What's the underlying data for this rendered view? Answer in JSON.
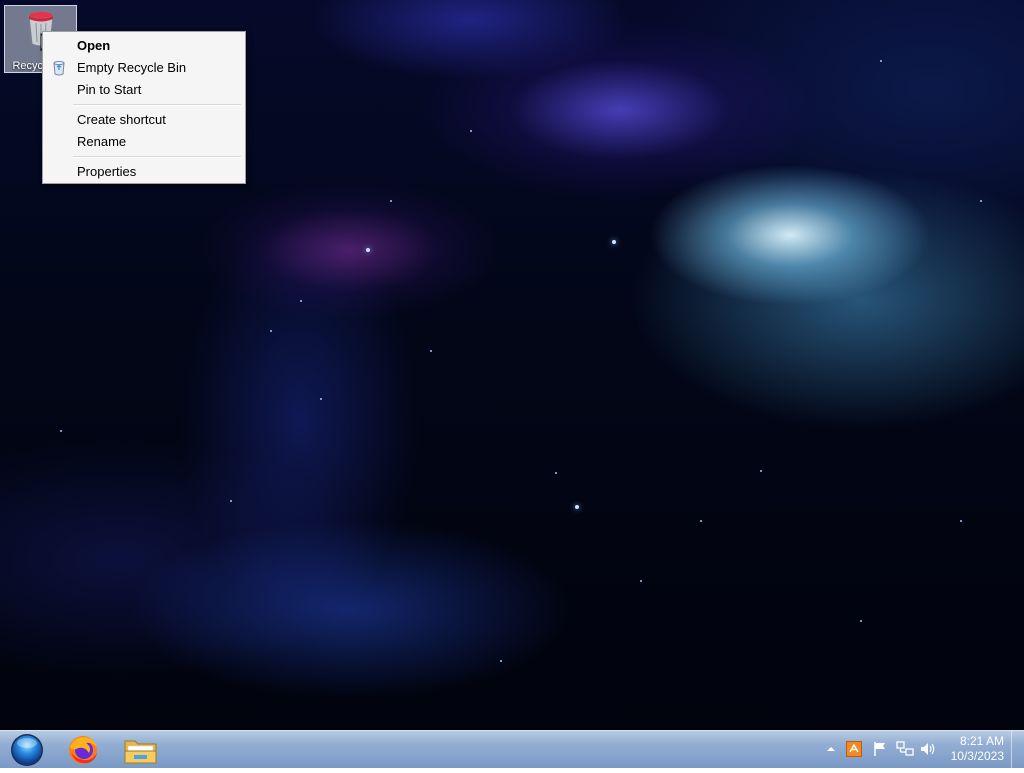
{
  "desktop": {
    "wallpaper": "nebula-space-wallpaper",
    "icons": [
      {
        "label": "Recycle Bin",
        "icon": "recycle-bin-icon"
      }
    ]
  },
  "context_menu": {
    "items": [
      {
        "label": "Open",
        "bold": true
      },
      {
        "label": "Empty Recycle Bin",
        "icon": "recycle-bin-small-icon"
      },
      {
        "label": "Pin to Start"
      },
      {
        "separator": true
      },
      {
        "label": "Create shortcut"
      },
      {
        "label": "Rename"
      },
      {
        "separator": true
      },
      {
        "label": "Properties"
      }
    ]
  },
  "taskbar": {
    "start_icon": "start-orb-icon",
    "pinned": [
      {
        "name": "Firefox",
        "icon": "firefox-icon"
      },
      {
        "name": "File Explorer",
        "icon": "file-explorer-icon"
      }
    ],
    "tray": {
      "icons": [
        "show-hidden-icons-arrow",
        "tray-app-icon",
        "action-center-flag-icon",
        "network-icon",
        "volume-icon"
      ],
      "time": "8:21 AM",
      "date": "10/3/2023"
    }
  },
  "colors": {
    "menu_bg": "#f5f5f5",
    "menu_border": "#a0a0a0",
    "taskbar_top": "#b9cbe3",
    "taskbar_bottom": "#7b99c6"
  }
}
